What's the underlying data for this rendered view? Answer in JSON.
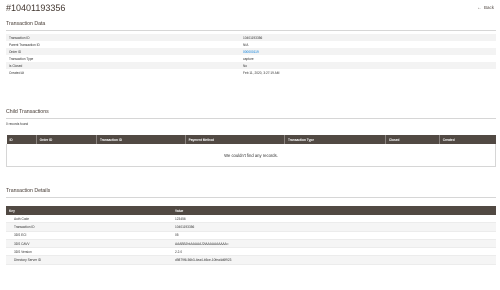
{
  "page": {
    "title": "#10401193356",
    "back_label": "Back"
  },
  "transaction_data": {
    "title": "Transaction Data",
    "rows": [
      {
        "key": "Transaction ID",
        "value": "10401193356",
        "link": false
      },
      {
        "key": "Parent Transaction ID",
        "value": "N/A",
        "link": false
      },
      {
        "key": "Order ID",
        "value": "000000119",
        "link": true
      },
      {
        "key": "Transaction Type",
        "value": "capture",
        "link": false
      },
      {
        "key": "Is Closed",
        "value": "No",
        "link": false
      },
      {
        "key": "Created At",
        "value": "Feb 11, 2020, 3:27:19 AM",
        "link": false
      }
    ]
  },
  "child_transactions": {
    "title": "Child Transactions",
    "records_found": "0 records found",
    "columns": [
      "ID",
      "Order ID",
      "Transaction ID",
      "Payment Method",
      "Transaction Type",
      "Closed",
      "Created"
    ],
    "empty_message": "We couldn't find any records."
  },
  "transaction_details": {
    "title": "Transaction Details",
    "columns": [
      "Key",
      "Value"
    ],
    "rows": [
      {
        "key": "Auth Code",
        "value": "123456"
      },
      {
        "key": "Transaction ID",
        "value": "10401193356"
      },
      {
        "key": "3DS ECI",
        "value": "05"
      },
      {
        "key": "3DS CAVV",
        "value": "AAABBJhkAAAAAJ2tAAAAAAAAAA="
      },
      {
        "key": "3DS Version",
        "value": "2.2.0"
      },
      {
        "key": "Directory Server ID",
        "value": "d9879f6-56b3-4ea4-b5ce-10fea4d6f923"
      }
    ]
  }
}
